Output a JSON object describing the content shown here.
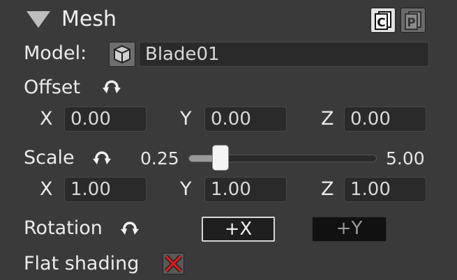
{
  "header": {
    "title": "Mesh",
    "collapse_icon": "collapse-triangle-icon",
    "copy_button_glyph": "C",
    "paste_button_glyph": "P"
  },
  "model": {
    "label": "Model:",
    "icon": "cube-icon",
    "value": "Blade01"
  },
  "offset": {
    "label": "Offset",
    "reset_icon": "reset-icon",
    "x_label": "X",
    "y_label": "Y",
    "z_label": "Z",
    "x": "0.00",
    "y": "0.00",
    "z": "0.00"
  },
  "scale": {
    "label": "Scale",
    "reset_icon": "reset-icon",
    "slider_min": "0.25",
    "slider_max": "5.00",
    "slider_value_fraction": 0.17,
    "x_label": "X",
    "y_label": "Y",
    "z_label": "Z",
    "x": "1.00",
    "y": "1.00",
    "z": "1.00"
  },
  "rotation": {
    "label": "Rotation",
    "reset_icon": "reset-icon",
    "plus_x": "+X",
    "plus_y": "+Y"
  },
  "flat_shading": {
    "label": "Flat shading",
    "checked_icon": "red-x-icon"
  },
  "colors": {
    "panel_bg": "#3a3a3a",
    "field_bg": "#2a2a2a",
    "checkbox_x": "#d81e1e"
  }
}
